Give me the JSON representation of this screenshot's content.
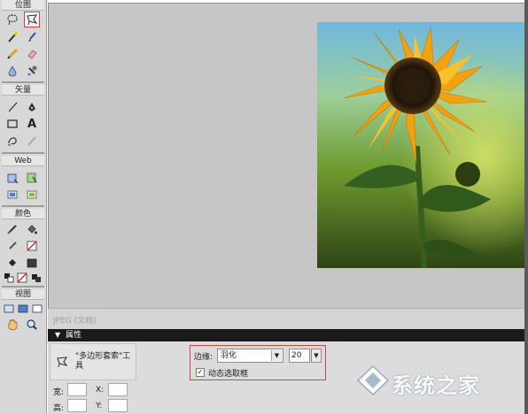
{
  "toolbar": {
    "sections": {
      "bitmap": "位图",
      "vector": "矢量",
      "web": "Web",
      "colors": "颜色",
      "view": "视图"
    },
    "vector_text_tool": "A"
  },
  "canvas": {
    "document_tab": "JPEG (文档)",
    "image_subject": "sunflower"
  },
  "properties": {
    "panel_title": "属性",
    "tool_name": "\"多边形套索\"工具",
    "width_label": "宽:",
    "height_label": "高:",
    "x_label": "X:",
    "y_label": "Y:",
    "edge_label": "边缘:",
    "edge_value": "羽化",
    "edge_amount": "20",
    "dynamic_marquee_label": "动态选取框",
    "dynamic_marquee_checked": "✓"
  },
  "watermark": {
    "text": "系统之家"
  },
  "colors": {
    "accent_highlight": "#e04040",
    "panel_header": "#1a1a1a",
    "canvas_bg": "#c6c6c6"
  }
}
